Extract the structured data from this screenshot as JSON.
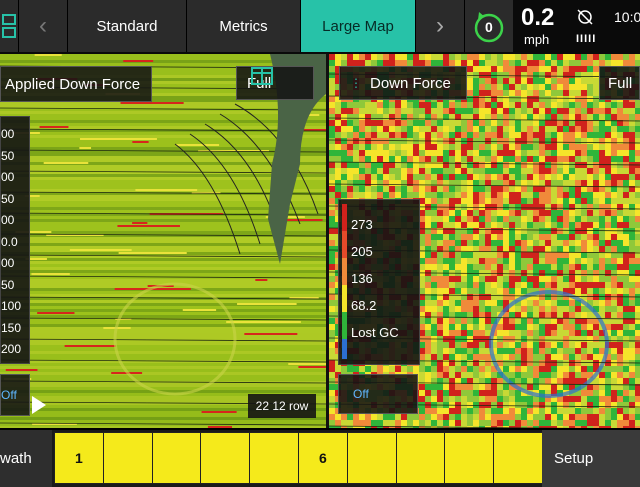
{
  "topbar": {
    "tabs": [
      {
        "label": "Standard"
      },
      {
        "label": "Metrics"
      },
      {
        "label": "Large Map"
      }
    ],
    "status_count": "0",
    "speed": "0.2",
    "speed_unit": "mph",
    "signal": "IIIII",
    "clock": "10:0"
  },
  "left_map": {
    "title": "Applied Down Force",
    "view_label": "Full",
    "legend_values": [
      "00",
      "50",
      "00",
      "50",
      "00",
      "0.0",
      "00",
      "50",
      "100",
      "150",
      "200"
    ],
    "toggle_label": "Off",
    "row_label": "22 12 row"
  },
  "right_map": {
    "title": "Down Force",
    "view_label": "Full",
    "legend": [
      {
        "label": "273",
        "color": "#d0221c"
      },
      {
        "label": "205",
        "color": "#e44a2a"
      },
      {
        "label": "136",
        "color": "#f08a3a"
      },
      {
        "label": "68.2",
        "color": "#f5e52a"
      },
      {
        "label": "Lost GC",
        "color": "#2fb53a"
      }
    ],
    "legend_bottom_color": "#2c6fd0",
    "toggle_label": "Off"
  },
  "bottombar": {
    "swath_label": "wath",
    "rows": [
      "1",
      "",
      "",
      "",
      "",
      "6",
      "",
      "",
      "",
      ""
    ],
    "setup_label": "Setup"
  },
  "colors": {
    "accent": "#27c2a8",
    "row_yellow": "#f5ea1b"
  }
}
